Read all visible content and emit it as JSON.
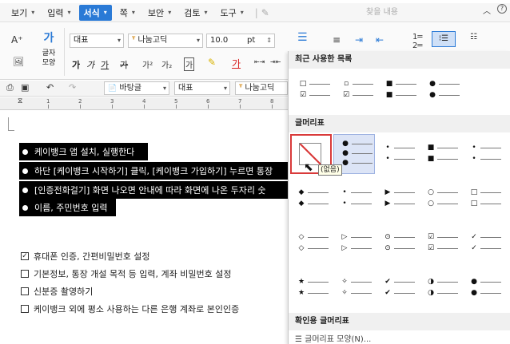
{
  "menubar": {
    "items": [
      {
        "label": "보기"
      },
      {
        "label": "입력"
      },
      {
        "label": "서식",
        "active": true
      },
      {
        "label": "쪽"
      },
      {
        "label": "보안"
      },
      {
        "label": "검토"
      },
      {
        "label": "도구"
      }
    ],
    "search_placeholder": "찾을 내용"
  },
  "ribbon": {
    "glyph_label": "글자 모양",
    "style_combo": "대표",
    "font_combo": "나눔고딕",
    "size_combo": "10.0",
    "size_unit": "pt",
    "format_buttons": [
      "가",
      "가",
      "가",
      "가"
    ],
    "accent_color": "#2a7ad6"
  },
  "toolbar2": {
    "para_combo": "바탕글",
    "style_combo": "대표",
    "font_combo": "나눔고딕"
  },
  "document": {
    "selected_bullets": [
      "케이뱅크 앱 설치, 실행한다",
      "하단 [케이뱅크 시작하기] 클릭, [케이뱅크 가입하기] 누르면 통장",
      "[인증전화걸기] 화면 나오면 안내에 따라 화면에 나온 두자리 숫",
      "이름, 주민번호 입력"
    ],
    "checklist": [
      {
        "label": "휴대폰 인증, 간편비밀번호 설정",
        "checked": true
      },
      {
        "label": "기본정보, 통장 개설 목적 등 입력, 계좌 비밀번호 설정",
        "checked": false
      },
      {
        "label": "신분증 촬영하기",
        "checked": false
      },
      {
        "label": "케이뱅크 외에 평소 사용하는 다른 은행 계좌로 본인인증",
        "checked": false
      }
    ]
  },
  "panel": {
    "recent_header": "최근 사용한 목록",
    "bullets_header": "글머리표",
    "check_header": "확인용 글머리표",
    "tooltip": "(없음)",
    "footer_item": "글머리표 모양(N)...",
    "recent": [
      {
        "symbols": [
          "□",
          "☑"
        ]
      },
      {
        "symbols": [
          "▫",
          "☑"
        ]
      },
      {
        "symbols": [
          "■",
          "■"
        ]
      },
      {
        "symbols": [
          "●",
          "●"
        ]
      }
    ],
    "rows": [
      [
        {
          "symbols": [],
          "none": true
        },
        {
          "symbols": [
            "●",
            "●",
            "●"
          ],
          "selected": true
        },
        {
          "symbols": [
            "•",
            "•"
          ]
        },
        {
          "symbols": [
            "■",
            "■"
          ]
        },
        {
          "symbols": [
            "•",
            "•"
          ]
        }
      ],
      [
        {
          "symbols": [
            "◆",
            "◆"
          ]
        },
        {
          "symbols": [
            "•",
            "•"
          ]
        },
        {
          "symbols": [
            "▶",
            "▶"
          ]
        },
        {
          "symbols": [
            "○",
            "○"
          ]
        },
        {
          "symbols": [
            "□",
            "□"
          ]
        }
      ],
      [
        {
          "symbols": [
            "◇",
            "◇"
          ]
        },
        {
          "symbols": [
            "▷",
            "▷"
          ]
        },
        {
          "symbols": [
            "⊙",
            "⊙"
          ]
        },
        {
          "symbols": [
            "☑",
            "☑"
          ]
        },
        {
          "symbols": [
            "✓",
            "✓"
          ]
        }
      ],
      [
        {
          "symbols": [
            "★",
            "★"
          ]
        },
        {
          "symbols": [
            "✧",
            "✧"
          ]
        },
        {
          "symbols": [
            "✔",
            "✔"
          ]
        },
        {
          "symbols": [
            "◑",
            "◑"
          ]
        },
        {
          "symbols": [
            "●",
            "●"
          ]
        }
      ]
    ]
  }
}
